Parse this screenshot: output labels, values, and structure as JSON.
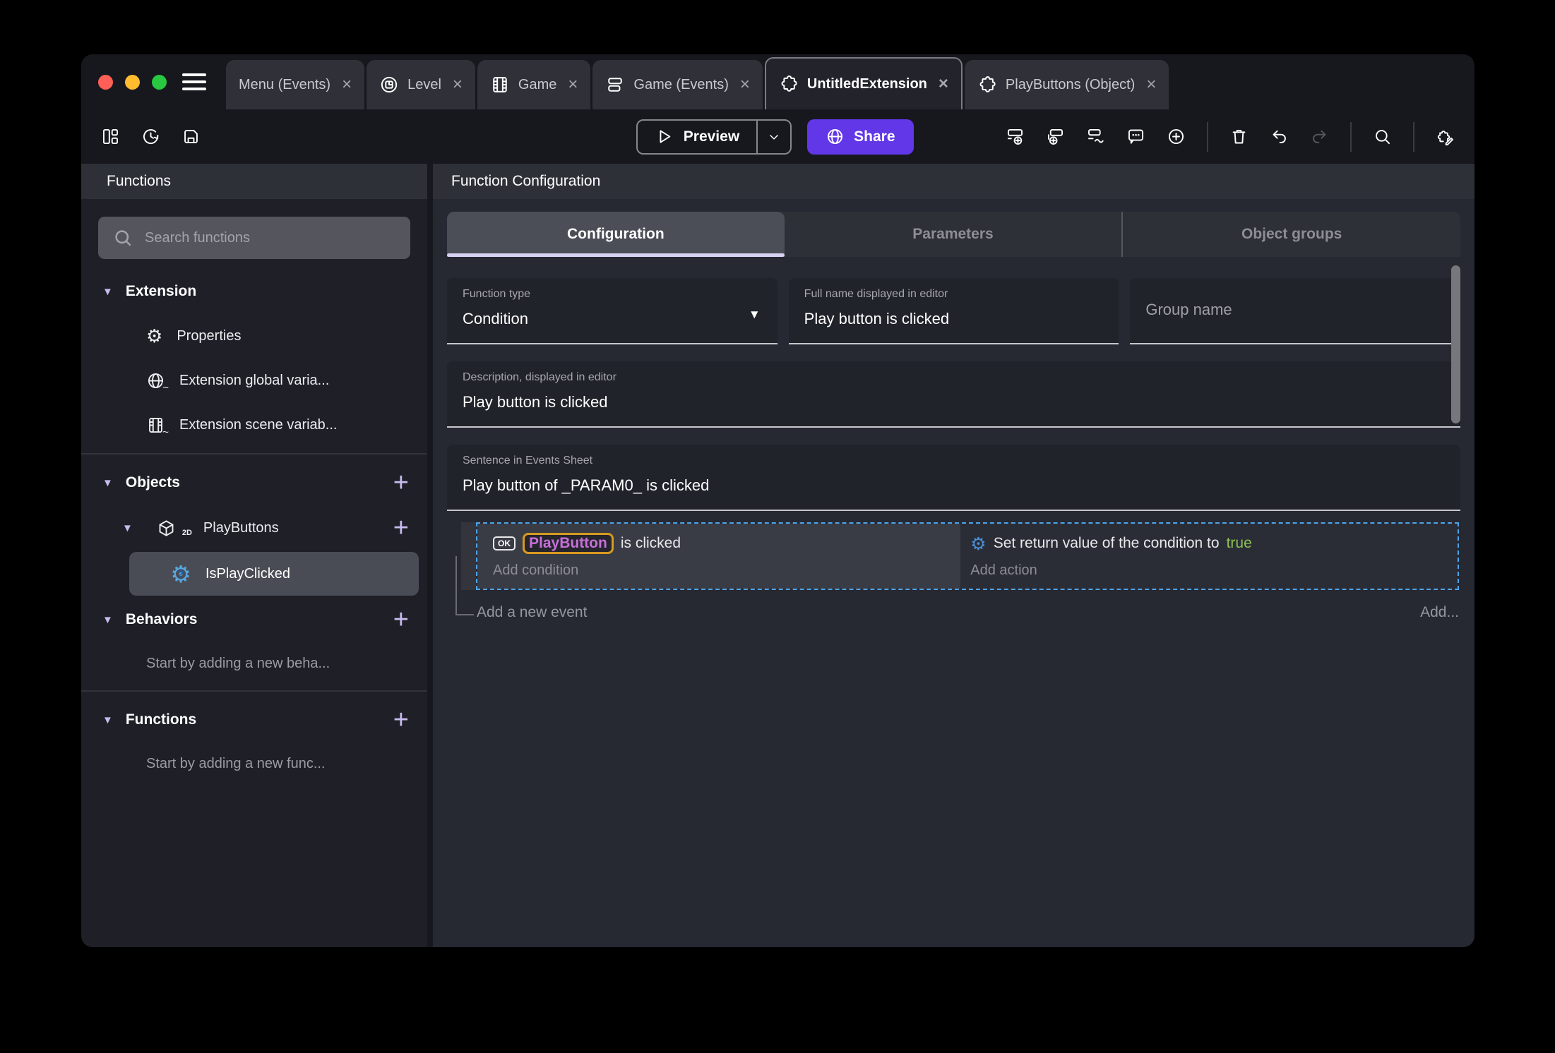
{
  "window": {
    "traffic_lights": {
      "close": "#ff5f57",
      "minimize": "#febc2e",
      "zoom": "#28c840"
    }
  },
  "titlebar": {
    "tabs": [
      {
        "label": "Menu (Events)",
        "icon": "none",
        "close": "×",
        "active": false
      },
      {
        "label": "Level",
        "icon": "scene-icon",
        "close": "×",
        "active": false
      },
      {
        "label": "Game",
        "icon": "film-icon",
        "close": "×",
        "active": false
      },
      {
        "label": "Game (Events)",
        "icon": "events-list-icon",
        "close": "×",
        "active": false
      },
      {
        "label": "UntitledExtension",
        "icon": "puzzle-icon",
        "close": "×",
        "active": true
      },
      {
        "label": "PlayButtons (Object)",
        "icon": "puzzle-icon",
        "close": "×",
        "active": false
      }
    ]
  },
  "toolbar": {
    "preview_label": "Preview",
    "share_label": "Share",
    "share_color": "#6137e8",
    "left_icons": [
      "layout-panels-icon",
      "history-icon",
      "save-icon"
    ],
    "right_icons": [
      "add-event-icon",
      "add-subevent-icon",
      "add-inline-event-icon",
      "comment-icon",
      "circle-plus-icon",
      "trash-icon",
      "undo-icon",
      "redo-icon",
      "search-icon",
      "edit-extension-icon"
    ]
  },
  "sidebar": {
    "title": "Functions",
    "search_placeholder": "Search functions",
    "extension_label": "Extension",
    "properties_label": "Properties",
    "global_vars_label": "Extension global varia...",
    "scene_vars_label": "Extension scene variab...",
    "objects_label": "Objects",
    "playbuttons_label": "PlayButtons",
    "playbuttons_badge": "2D",
    "isplayclicked_label": "IsPlayClicked",
    "behaviors_label": "Behaviors",
    "behaviors_empty": "Start by adding a new beha...",
    "functions_label": "Functions",
    "functions_empty": "Start by adding a new func..."
  },
  "main": {
    "header": "Function Configuration",
    "tabs": [
      {
        "label": "Configuration",
        "active": true
      },
      {
        "label": "Parameters",
        "active": false
      },
      {
        "label": "Object groups",
        "active": false
      }
    ],
    "function_type": {
      "label": "Function type",
      "value": "Condition"
    },
    "full_name": {
      "label": "Full name displayed in editor",
      "value": "Play button is clicked"
    },
    "group_name": {
      "placeholder": "Group name"
    },
    "description": {
      "label": "Description, displayed in editor",
      "value": "Play button is clicked"
    },
    "sentence": {
      "label": "Sentence in Events Sheet",
      "value": "Play button of _PARAM0_ is clicked"
    },
    "events": {
      "condition": {
        "object_icon_text": "OK",
        "object_name": "PlayButton",
        "text": "is clicked",
        "add_label": "Add condition",
        "param_color": "#c66fd8",
        "param_border_color": "#d89a1e"
      },
      "action": {
        "icon": "gdevelop-gear-icon",
        "text": "Set return value of the condition to",
        "value": "true",
        "value_color": "#8cc152",
        "add_label": "Add action"
      },
      "selection_color": "#4da4e8",
      "add_event_label": "Add a new event",
      "add_more_label": "Add..."
    }
  }
}
